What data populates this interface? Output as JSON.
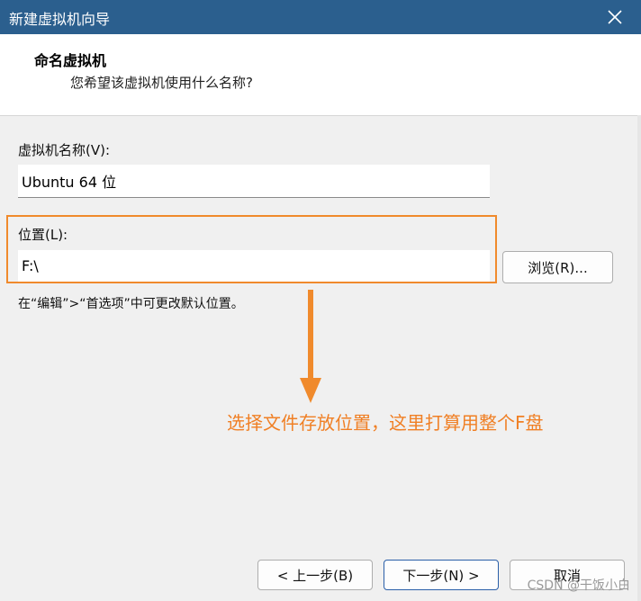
{
  "window": {
    "title": "新建虚拟机向导"
  },
  "header": {
    "title": "命名虚拟机",
    "subtitle": "您希望该虚拟机使用什么名称?"
  },
  "form": {
    "name_label": "虚拟机名称(V):",
    "name_value": "Ubuntu 64 位",
    "location_label": "位置(L):",
    "location_value": "F:\\",
    "browse_label": "浏览(R)...",
    "hint": "在“编辑”>“首选项”中可更改默认位置。"
  },
  "annotation": {
    "text": "选择文件存放位置，这里打算用整个F盘",
    "color": "#f07f24"
  },
  "footer": {
    "back_label": "< 上一步(B)",
    "next_label": "下一步(N) >",
    "cancel_label": "取消"
  },
  "watermark": {
    "text": "CSDN @干饭小白"
  },
  "colors": {
    "titlebar": "#2b5f8e",
    "accent": "#f08a2c",
    "primary_border": "#2a5fa8"
  },
  "icons": {
    "close": "close-icon",
    "arrow": "arrow-down-icon"
  }
}
